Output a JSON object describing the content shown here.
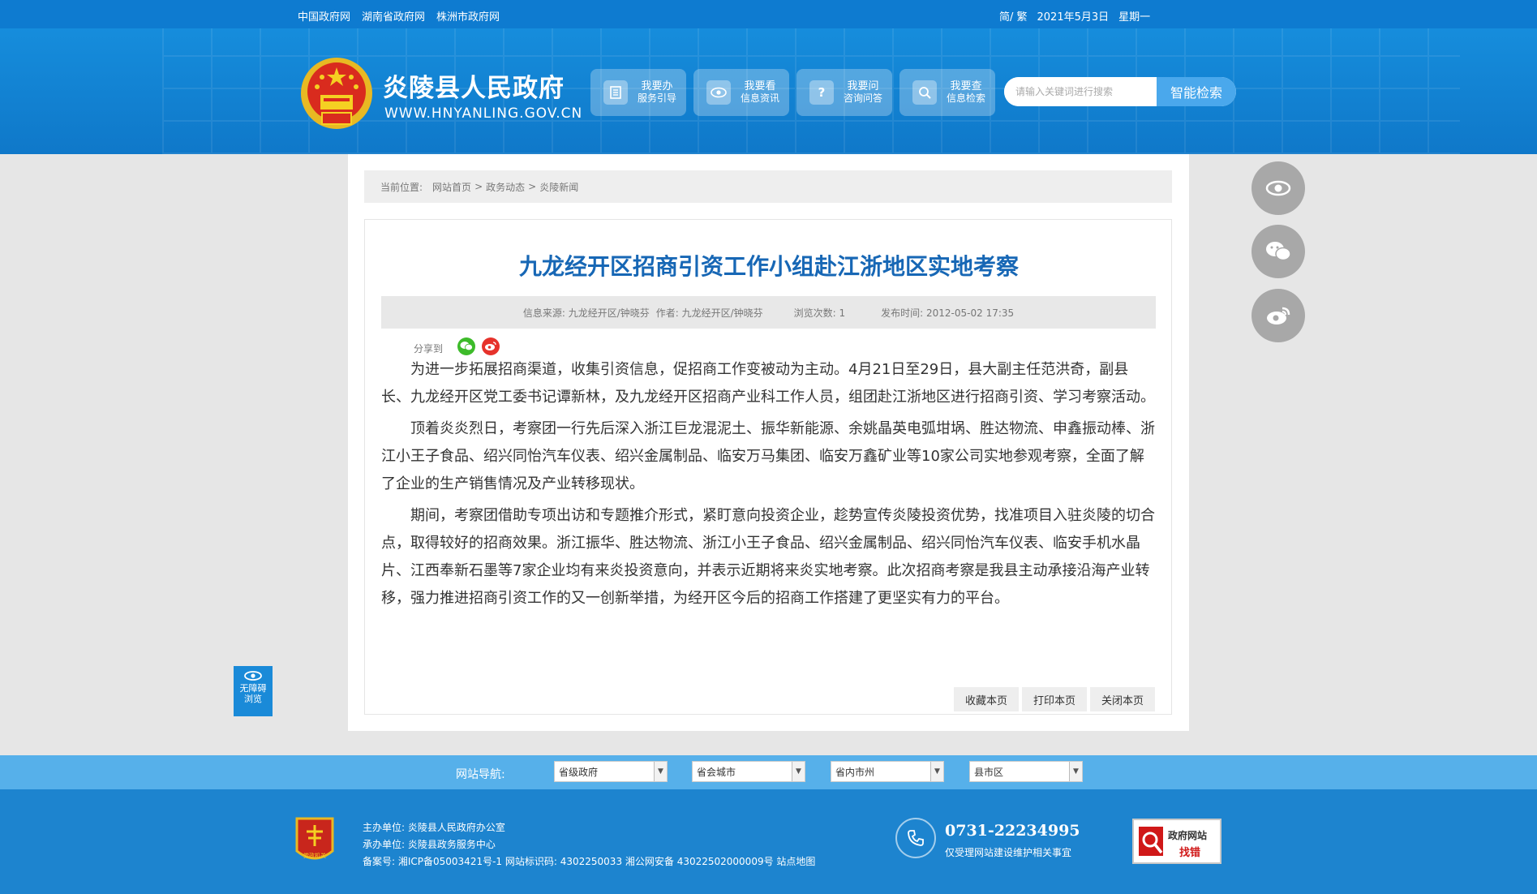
{
  "topbar": {
    "links": [
      "中国政府网",
      "湖南省政府网",
      "株洲市政府网"
    ],
    "lang": "简/ 繁",
    "date": "2021年5月3日",
    "weekday": "星期一"
  },
  "header": {
    "site_name": "炎陵县人民政府",
    "site_url": "WWW.HNYANLING.GOV.CN",
    "nav": [
      {
        "l1": "我要办",
        "l2": "服务引导",
        "icon": "document-icon"
      },
      {
        "l1": "我要看",
        "l2": "信息资讯",
        "icon": "eye-icon"
      },
      {
        "l1": "我要问",
        "l2": "咨询问答",
        "icon": "question-icon"
      },
      {
        "l1": "我要查",
        "l2": "信息检索",
        "icon": "search-icon"
      }
    ],
    "search_placeholder": "请输入关键词进行搜索",
    "search_button": "智能检索"
  },
  "breadcrumb": {
    "label": "当前位置:",
    "items": [
      "网站首页",
      "政务动态",
      "炎陵新闻"
    ]
  },
  "article": {
    "title": "九龙经开区招商引资工作小组赴江浙地区实地考察",
    "source": "信息来源: 九龙经开区/钟晓芬",
    "author": "作者: 九龙经开区/钟晓芬",
    "views": "浏览次数: 1",
    "published": "发布时间: 2012-05-02 17:35",
    "share_label": "分享到",
    "paragraphs": [
      "为进一步拓展招商渠道，收集引资信息，促招商工作变被动为主动。4月21日至29日，县大副主任范洪奇，副县长、九龙经开区党工委书记谭新林，及九龙经开区招商产业科工作人员，组团赴江浙地区进行招商引资、学习考察活动。",
      "顶着炎炎烈日，考察团一行先后深入浙江巨龙混泥土、振华新能源、余姚晶英电弧坩埚、胜达物流、申鑫振动棒、浙江小王子食品、绍兴同怡汽车仪表、绍兴金属制品、临安万马集团、临安万鑫矿业等10家公司实地参观考察，全面了解了企业的生产销售情况及产业转移现状。",
      "期间，考察团借助专项出访和专题推介形式，紧盯意向投资企业，趁势宣传炎陵投资优势，找准项目入驻炎陵的切合点，取得较好的招商效果。浙江振华、胜达物流、浙江小王子食品、绍兴金属制品、绍兴同怡汽车仪表、临安手机水晶片、江西奉新石墨等7家企业均有来炎投资意向，并表示近期将来炎实地考察。此次招商考察是我县主动承接沿海产业转移，强力推进招商引资工作的又一创新举措，为经开区今后的招商工作搭建了更坚实有力的平台。"
    ],
    "actions": [
      "收藏本页",
      "打印本页",
      "关闭本页"
    ]
  },
  "accessibility": {
    "l1": "无障碍",
    "l2": "浏览"
  },
  "footer_nav": {
    "label": "网站导航:",
    "selects": [
      "省级政府",
      "省会城市",
      "省内市州",
      "县市区"
    ]
  },
  "footer": {
    "host": "主办单位: 炎陵县人民政府办公室",
    "organizer": "承办单位: 炎陵县政务服务中心",
    "icp": "备案号: 湘ICP备05003421号-1 网站标识码: 4302250033 湘公网安备 43022502000009号 站点地图",
    "badge_text": "党政机关",
    "phone": "0731-22234995",
    "phone_note": "仅受理网站建设维护相关事宜",
    "err_l1": "政府网站",
    "err_l2": "找错"
  },
  "colors": {
    "primary": "#0e7bd0",
    "title_blue": "#1767b5",
    "footer_nav": "#56b0ea",
    "footer": "#1d84cf"
  }
}
